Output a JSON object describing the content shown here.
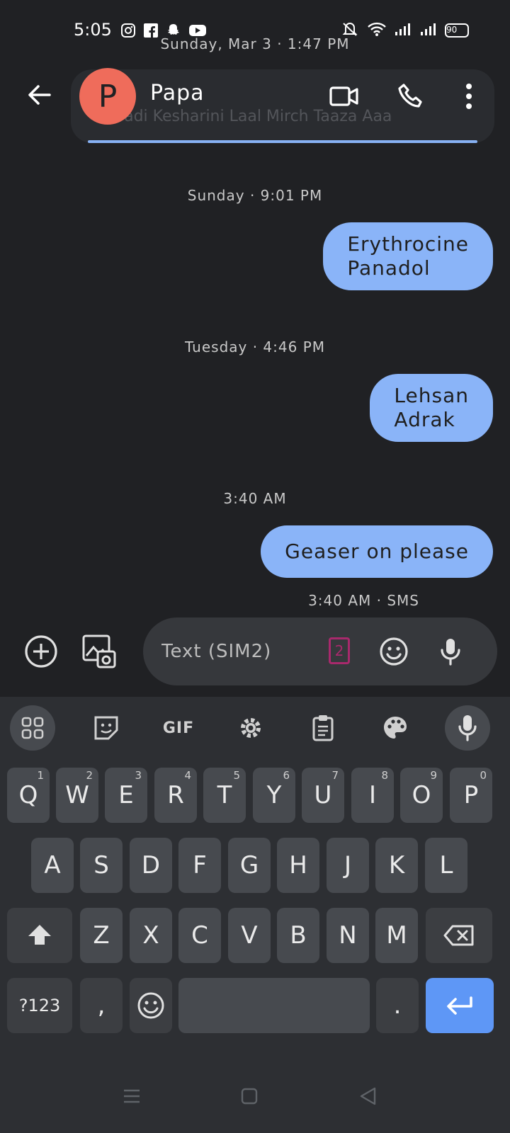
{
  "status_bar": {
    "time": "5:05",
    "battery": "90",
    "app_icons": [
      "instagram-icon",
      "facebook-icon",
      "snapchat-icon",
      "youtube-icon"
    ],
    "right_icons": [
      "mute-vibrate-icon",
      "wifi-icon",
      "signal-sim1-icon",
      "signal-sim2-icon",
      "battery-icon"
    ]
  },
  "header": {
    "scroll_timestamp": "Sunday, Mar 3 · 1:47 PM",
    "ghost_preview": "Badi Kesharini Laal Mirch Taaza Aaa",
    "contact_name": "Papa",
    "avatar_letter": "P"
  },
  "messages": [
    {
      "timestamp": "Sunday · 9:01 PM",
      "lines": [
        "Erythrocine",
        "Panadol"
      ]
    },
    {
      "timestamp": "Tuesday · 4:46 PM",
      "lines": [
        "Lehsan",
        "Adrak"
      ]
    },
    {
      "timestamp": "3:40 AM",
      "lines": [
        "Geaser on please"
      ]
    }
  ],
  "last_message_meta": "3:40 AM · SMS",
  "composer": {
    "placeholder": "Text (SIM2)",
    "sim_badge": "2"
  },
  "keyboard": {
    "toolbar": {
      "gif_label": "GIF"
    },
    "row1": [
      {
        "key": "Q",
        "hint": "1"
      },
      {
        "key": "W",
        "hint": "2"
      },
      {
        "key": "E",
        "hint": "3"
      },
      {
        "key": "R",
        "hint": "4"
      },
      {
        "key": "T",
        "hint": "5"
      },
      {
        "key": "Y",
        "hint": "6"
      },
      {
        "key": "U",
        "hint": "7"
      },
      {
        "key": "I",
        "hint": "8"
      },
      {
        "key": "O",
        "hint": "9"
      },
      {
        "key": "P",
        "hint": "0"
      }
    ],
    "row2": [
      "A",
      "S",
      "D",
      "F",
      "G",
      "H",
      "J",
      "K",
      "L"
    ],
    "row3": [
      "Z",
      "X",
      "C",
      "V",
      "B",
      "N",
      "M"
    ],
    "symbols_label": "?123",
    "comma": ",",
    "period": "."
  },
  "colors": {
    "background": "#202124",
    "bubble": "#8ab4f8",
    "avatar": "#ef6c5b",
    "enter_key": "#5e97f6",
    "sim_badge": "#a8296c"
  }
}
